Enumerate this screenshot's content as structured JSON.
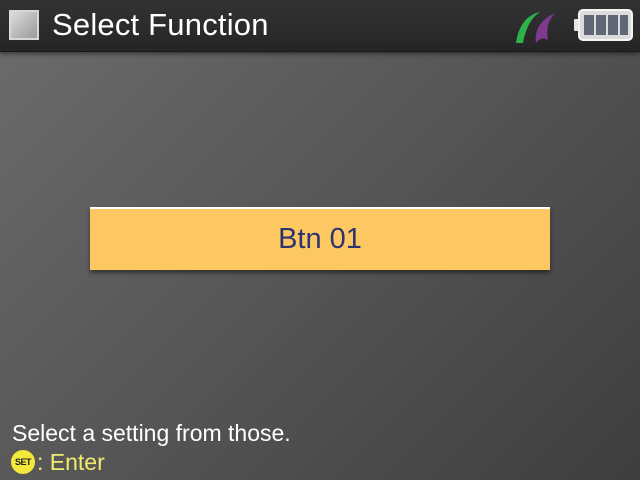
{
  "header": {
    "title": "Select Function",
    "menu_icon": "menu-square-icon",
    "status_icons": [
      "leaf-icon",
      "battery-full-icon"
    ]
  },
  "main": {
    "selected_function": "Btn 01"
  },
  "footer": {
    "hint": "Select a setting from those.",
    "set_badge": "SET",
    "set_action": ": Enter"
  },
  "colors": {
    "button_fill": "#fdc862",
    "button_text": "#2e3470",
    "set_badge": "#f3e93a",
    "enter_text": "#f0ec6e",
    "leaf_green": "#2db34a",
    "leaf_purple": "#7d3a8f"
  },
  "battery": {
    "level": 1.0
  }
}
